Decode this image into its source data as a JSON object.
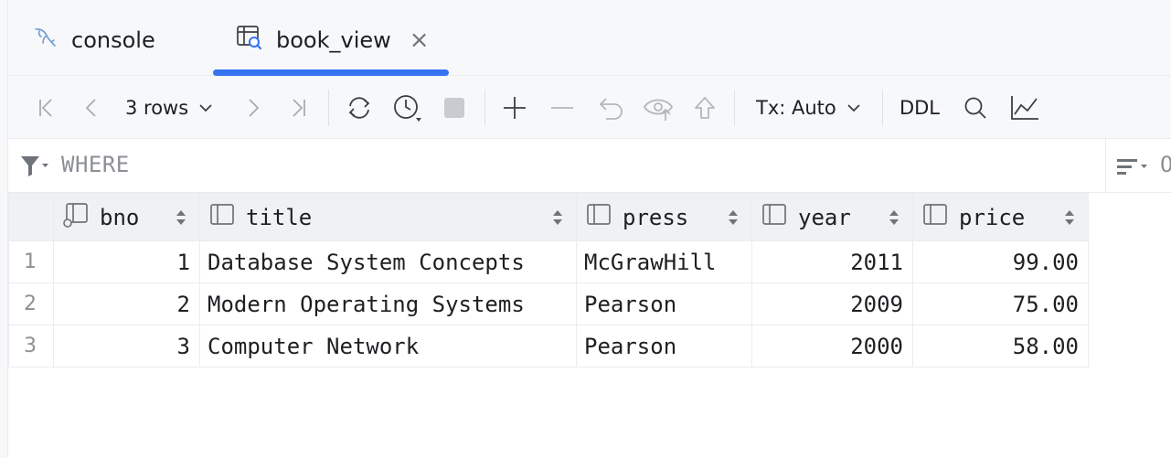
{
  "tabs": [
    {
      "label": "console",
      "icon": "mysql-dolphin-icon",
      "active": false
    },
    {
      "label": "book_view",
      "icon": "table-view-icon",
      "active": true,
      "closable": true
    }
  ],
  "toolbar": {
    "rows_label": "3 rows",
    "tx_label": "Tx: Auto",
    "ddl_label": "DDL"
  },
  "filter": {
    "where_placeholder": "WHERE",
    "orderby_placeholder": "O"
  },
  "grid": {
    "columns": [
      "bno",
      "title",
      "press",
      "year",
      "price"
    ],
    "rows": [
      {
        "num": "1",
        "bno": "1",
        "title": "Database System Concepts",
        "press": "McGrawHill",
        "year": "2011",
        "price": "99.00"
      },
      {
        "num": "2",
        "bno": "2",
        "title": "Modern Operating Systems",
        "press": "Pearson",
        "year": "2009",
        "price": "75.00"
      },
      {
        "num": "3",
        "bno": "3",
        "title": "Computer Network",
        "press": "Pearson",
        "year": "2000",
        "price": "58.00"
      }
    ]
  },
  "colors": {
    "accent": "#3574f0",
    "icon_gray": "#6f737a",
    "muted_text": "#8c8f96"
  }
}
